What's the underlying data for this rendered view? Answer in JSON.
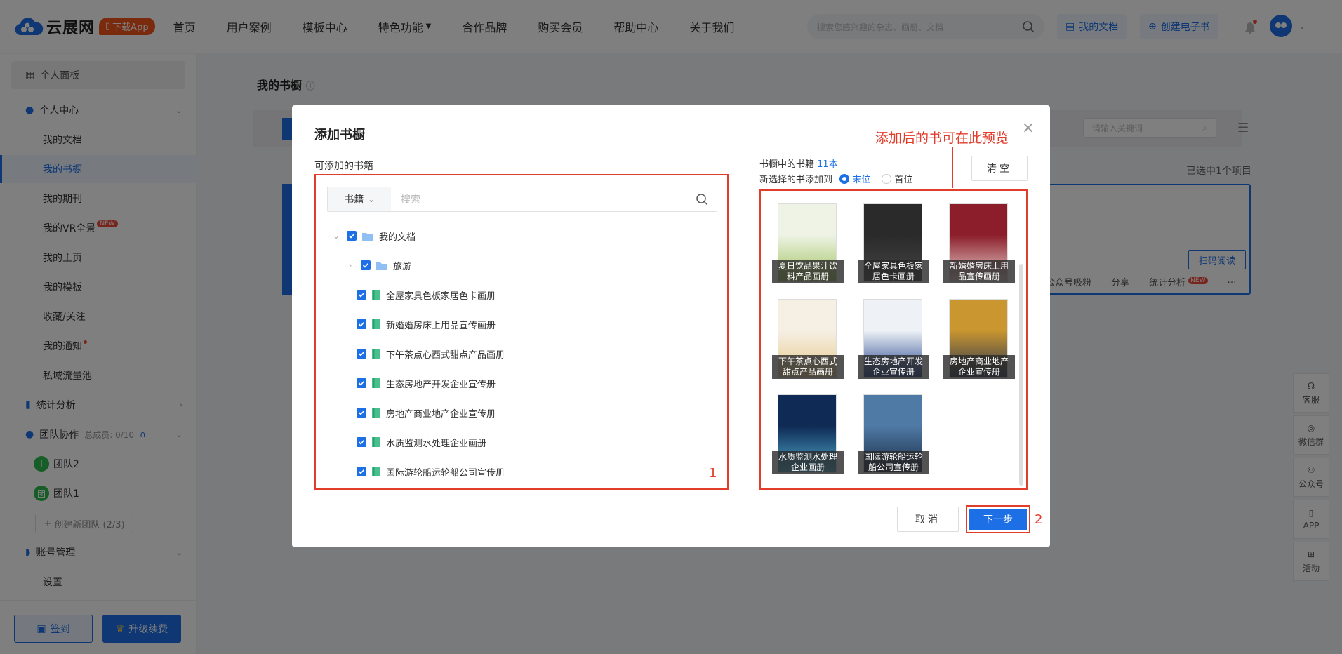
{
  "header": {
    "logo_text": "云展网",
    "app_badge": "下载App",
    "nav": [
      "首页",
      "用户案例",
      "模板中心",
      "特色功能",
      "合作品牌",
      "购买会员",
      "帮助中心",
      "关于我们"
    ],
    "search_placeholder": "搜索您感兴趣的杂志、画册、文档",
    "my_docs": "我的文档",
    "create_ebook": "创建电子书"
  },
  "sidebar": {
    "panel": "个人面板",
    "personal_center": "个人中心",
    "items": [
      "我的文档",
      "我的书橱",
      "我的期刊",
      "我的VR全景",
      "我的主页",
      "我的模板",
      "收藏/关注",
      "我的通知",
      "私域流量池"
    ],
    "vr_badge": "NEW",
    "stats": "统计分析",
    "team": "团队协作",
    "team_members": "总成员: 0/10",
    "teams": [
      {
        "icon": "I",
        "name": "团队2"
      },
      {
        "icon": "团",
        "name": "团队1"
      }
    ],
    "create_team": "创建新团队 (2/3)",
    "account": "账号管理",
    "settings": "设置",
    "signin": "签到",
    "upgrade": "升级续费"
  },
  "main": {
    "title": "我的书橱",
    "search_placeholder": "请输入关键词",
    "selected": "已选中1个项目",
    "qr_read": "扫码阅读",
    "actions": [
      "公众号吸粉",
      "分享",
      "统计分析"
    ],
    "new_badge": "NEW",
    "side_tools": [
      "客服",
      "微信群",
      "公众号",
      "APP",
      "活动"
    ]
  },
  "modal": {
    "title": "添加书橱",
    "left_label": "可添加的书籍",
    "search_type": "书籍",
    "search_placeholder": "搜索",
    "tree": [
      {
        "name": "我的文档",
        "level": 0,
        "type": "folder"
      },
      {
        "name": "旅游",
        "level": 1,
        "type": "folder"
      },
      {
        "name": "全屋家具色板家居色卡画册",
        "level": 2,
        "type": "book"
      },
      {
        "name": "新婚婚房床上用品宣传画册",
        "level": 2,
        "type": "book"
      },
      {
        "name": "下午茶点心西式甜点产品画册",
        "level": 2,
        "type": "book"
      },
      {
        "name": "生态房地产开发企业宣传册",
        "level": 2,
        "type": "book"
      },
      {
        "name": "房地产商业地产企业宣传册",
        "level": 2,
        "type": "book"
      },
      {
        "name": "水质监测水处理企业画册",
        "level": 2,
        "type": "book"
      },
      {
        "name": "国际游轮船运轮船公司宣传册",
        "level": 2,
        "type": "book"
      }
    ],
    "box1_num": "1",
    "count_label": "书橱中的书籍",
    "count_value": "11本",
    "add_pos_label": "新选择的书添加到",
    "pos_end": "末位",
    "pos_start": "首位",
    "clear": "清空",
    "books": [
      {
        "l1": "夏日饮品果汁饮",
        "l2": "料产品画册",
        "c1": "#eef3e6",
        "c2": "#9fc15a"
      },
      {
        "l1": "全屋家具色板家",
        "l2": "居色卡画册",
        "c1": "#2a2a2a",
        "c2": "#444444"
      },
      {
        "l1": "新婚婚房床上用",
        "l2": "品宣传画册",
        "c1": "#8b1e2a",
        "c2": "#e8d3cf"
      },
      {
        "l1": "下午茶点心西式",
        "l2": "甜点产品画册",
        "c1": "#f5efe4",
        "c2": "#e7c98a"
      },
      {
        "l1": "生态房地产开发",
        "l2": "企业宣传册",
        "c1": "#eef2f7",
        "c2": "#1f3f8a"
      },
      {
        "l1": "房地产商业地产",
        "l2": "企业宣传册",
        "c1": "#c9962f",
        "c2": "#2b3550"
      },
      {
        "l1": "水质监测水处理",
        "l2": "企业画册",
        "c1": "#0e2a55",
        "c2": "#4fa9c9"
      },
      {
        "l1": "国际游轮船运轮",
        "l2": "船公司宣传册",
        "c1": "#4f7aa5",
        "c2": "#1b2b44"
      }
    ],
    "annotation": "添加后的书可在此预览",
    "cancel": "取消",
    "next": "下一步",
    "box2_num": "2"
  }
}
